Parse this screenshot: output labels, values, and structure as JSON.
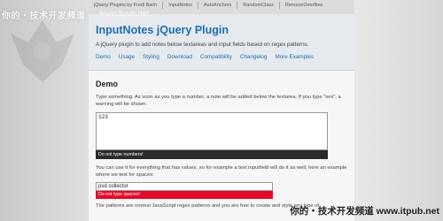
{
  "top_watermark": {
    "brand": "你的・技术开发频道",
    "url": "www.itpub.net"
  },
  "top_nav": {
    "items": [
      "jQuery Plugins by Fredi Bach",
      "InputNotes",
      "AutoAnchors",
      "RandomClass",
      "RemoveOverflow"
    ]
  },
  "header": {
    "title": "InputNotes jQuery Plugin",
    "subtitle": "A jQuery plugin to add notes below textareas and input fields based on regex patterns.",
    "links": [
      "Demo",
      "Usage",
      "Styling",
      "Download",
      "Compatibility",
      "Changelog",
      "More Examples"
    ]
  },
  "demo": {
    "title": "Demo",
    "intro": "Type something. As soon as you type a number, a note will be added below the textarea. If you type \"sex\", a warning will be shown.",
    "textarea_value": "123",
    "textarea_note": "Do not type numbers!",
    "para2": "You can use it for everything that has values, so for example a text inputfield will do it as well, here an example where we test for spaces:",
    "input_value": "psd collector",
    "input_note": "Do not type spaces!",
    "para3": "The patterns are normal JavaScript regex patterns and you are free to create and style any type of"
  },
  "bottom_watermark": {
    "brand": "你的・技术开发频道",
    "url": "www.itpub.net"
  },
  "colors": {
    "accent": "#1e6fb0",
    "warning": "#e30b2a",
    "note_dark": "#2b2b2b"
  }
}
